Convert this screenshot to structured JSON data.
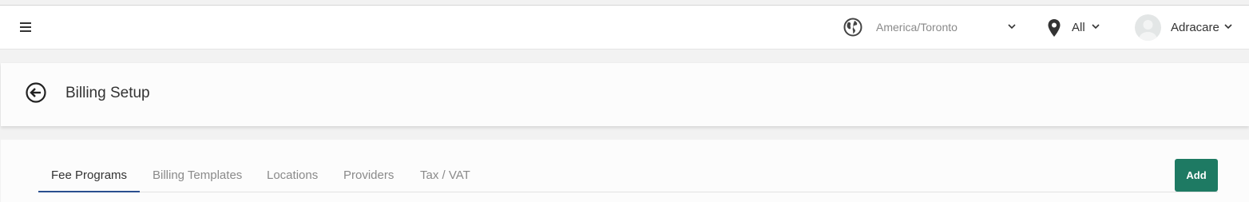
{
  "header": {
    "menu_icon": "hamburger-menu-icon",
    "timezone_icon": "globe-icon",
    "timezone": "America/Toronto",
    "location_icon": "map-pin-icon",
    "location": "All",
    "user_name": "Adracare"
  },
  "page": {
    "back_icon": "arrow-left-circle-icon",
    "title": "Billing Setup"
  },
  "tabs": [
    {
      "label": "Fee Programs",
      "active": true
    },
    {
      "label": "Billing Templates",
      "active": false
    },
    {
      "label": "Locations",
      "active": false
    },
    {
      "label": "Providers",
      "active": false
    },
    {
      "label": "Tax / VAT",
      "active": false
    }
  ],
  "actions": {
    "add_label": "Add"
  },
  "colors": {
    "accent_tab": "#2a4f8f",
    "add_button": "#1e7a63"
  }
}
